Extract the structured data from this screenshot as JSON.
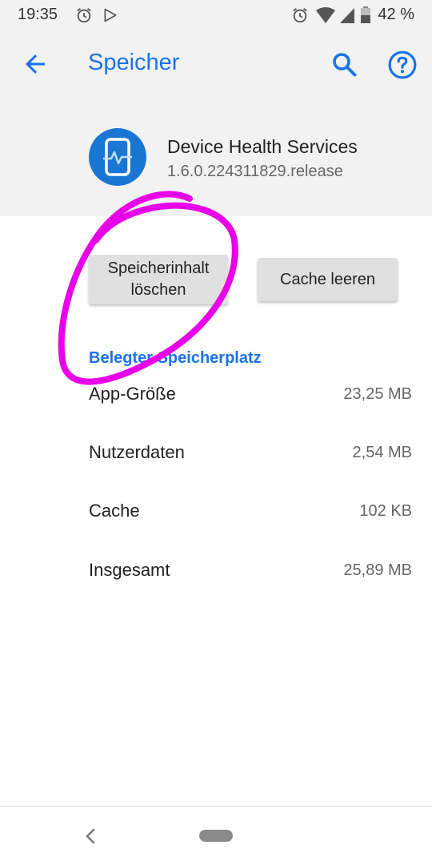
{
  "status_bar": {
    "time": "19:35",
    "battery_text": "42 %",
    "icons": [
      "alarm-icon",
      "play-store-icon",
      "alarm-icon",
      "wifi-icon",
      "signal-icon",
      "battery-icon"
    ]
  },
  "app_bar": {
    "title": "Speicher",
    "back_icon": "arrow-back-icon",
    "search_icon": "search-icon",
    "help_icon": "help-icon"
  },
  "app_info": {
    "name": "Device Health Services",
    "version": "1.6.0.224311829.release",
    "icon": "device-health-icon"
  },
  "actions": {
    "clear_storage_label": "Speicherinhalt löschen",
    "clear_cache_label": "Cache leeren"
  },
  "storage": {
    "section_title": "Belegter Speicherplatz",
    "rows": [
      {
        "label": "App-Größe",
        "value": "23,25 MB"
      },
      {
        "label": "Nutzerdaten",
        "value": "2,54 MB"
      },
      {
        "label": "Cache",
        "value": "102 KB"
      },
      {
        "label": "Insgesamt",
        "value": "25,89 MB"
      }
    ]
  },
  "colors": {
    "accent": "#1a73e8",
    "annotation": "#e800e8",
    "app_icon_bg": "#1976d2"
  },
  "nav_bar": {
    "back_icon": "nav-back-icon",
    "home_icon": "nav-home-pill"
  }
}
